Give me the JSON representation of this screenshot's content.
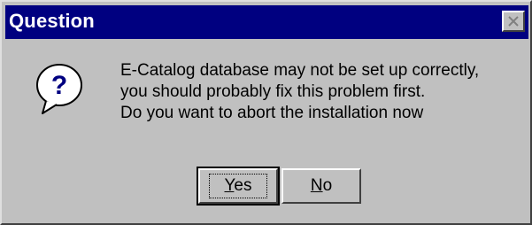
{
  "window": {
    "title": "Question",
    "close_icon": "close-icon"
  },
  "icon": {
    "name": "question-icon",
    "glyph": "?"
  },
  "message": {
    "line1": "E-Catalog database may not be set up correctly,",
    "line2": "you should probably fix this problem first.",
    "line3": "Do you want to abort the installation now"
  },
  "buttons": {
    "yes_mnemonic": "Y",
    "yes_rest": "es",
    "no_mnemonic": "N",
    "no_rest": "o"
  },
  "colors": {
    "titlebar": "#000080",
    "face": "#c0c0c0",
    "icon_blue": "#000080"
  }
}
